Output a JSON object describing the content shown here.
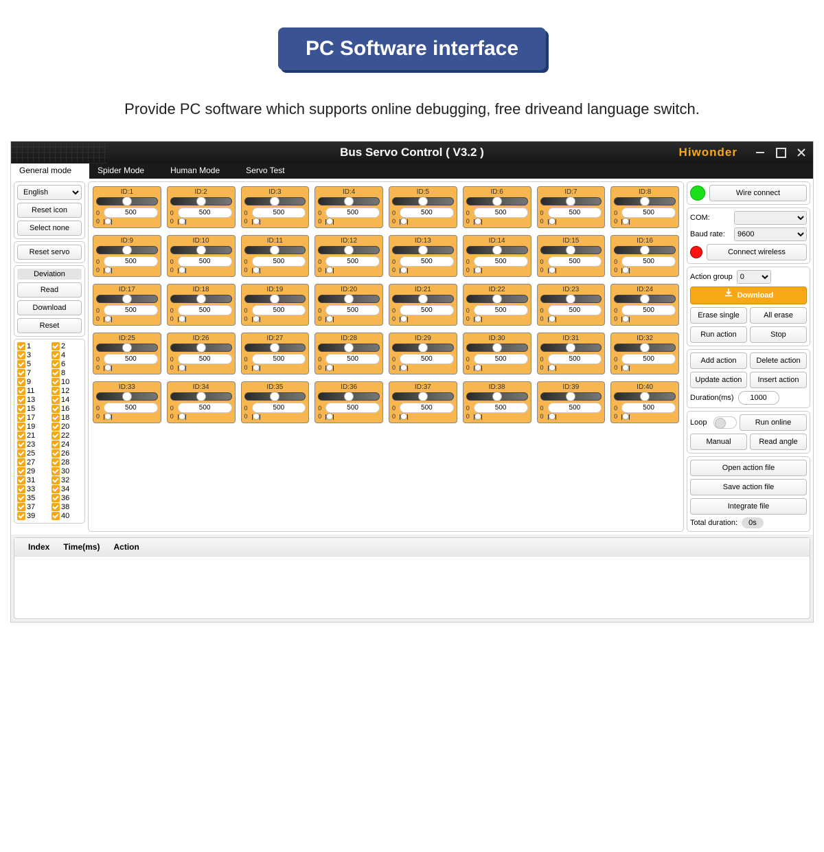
{
  "banner": "PC Software interface",
  "subtitle": "Provide PC software which supports online debugging, free driveand language switch.",
  "titlebar": {
    "title": "Bus Servo Control ( V3.2 )",
    "logo": "Hiwonder"
  },
  "tabs": [
    "General mode",
    "Spider Mode",
    "Human Mode",
    "Servo Test"
  ],
  "left": {
    "language": "English",
    "reset_icon": "Reset icon",
    "select_none": "Select none",
    "reset_servo": "Reset servo",
    "deviation_label": "Deviation",
    "read": "Read",
    "download": "Download",
    "reset": "Reset"
  },
  "servo": {
    "value": "500",
    "zero": "0",
    "id_prefix": "ID:",
    "count": 40
  },
  "right": {
    "wire_connect": "Wire connect",
    "com_label": "COM:",
    "baud_label": "Baud rate:",
    "baud_value": "9600",
    "connect_wireless": "Connect wireless",
    "action_group_label": "Action group",
    "action_group_value": "0",
    "download": "Download",
    "erase_single": "Erase single",
    "all_erase": "All erase",
    "run_action": "Run action",
    "stop": "Stop",
    "add_action": "Add action",
    "delete_action": "Delete action",
    "update_action": "Update action",
    "insert_action": "Insert action",
    "duration_label": "Duration(ms)",
    "duration_value": "1000",
    "loop_label": "Loop",
    "run_online": "Run online",
    "manual": "Manual",
    "read_angle": "Read angle",
    "open_file": "Open action file",
    "save_file": "Save action file",
    "integrate_file": "Integrate file",
    "total_duration_label": "Total duration:",
    "total_duration_value": "0s"
  },
  "table": {
    "col_index": "Index",
    "col_time": "Time(ms)",
    "col_action": "Action"
  }
}
